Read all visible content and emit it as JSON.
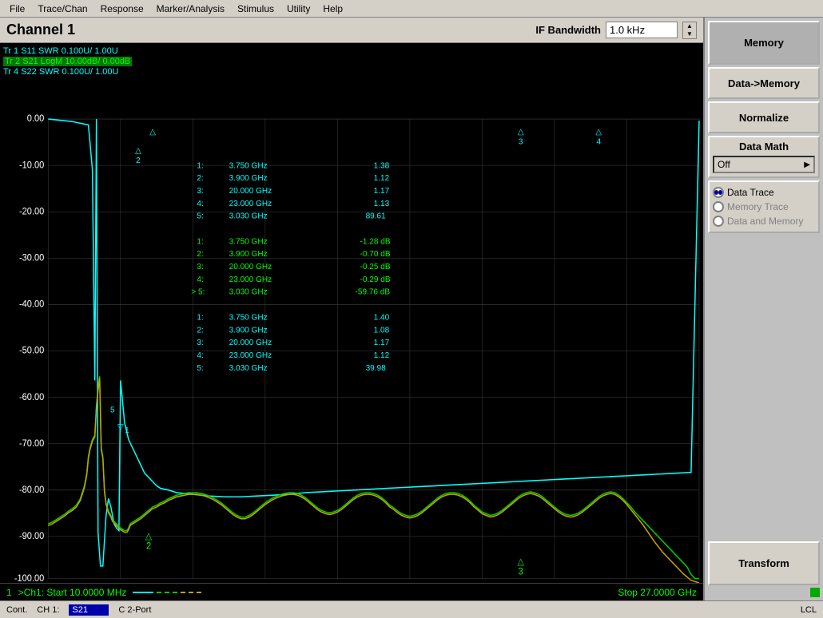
{
  "menubar": {
    "items": [
      "File",
      "Trace/Chan",
      "Response",
      "Marker/Analysis",
      "Stimulus",
      "Utility",
      "Help"
    ]
  },
  "header": {
    "channel_label": "Channel 1",
    "if_bandwidth_label": "IF Bandwidth",
    "if_bandwidth_value": "1.0 kHz"
  },
  "traces": {
    "tr1": "Tr 1  S11 SWR 0.100U/  1.00U",
    "tr2": "Tr 2  S21 LogM 10.00dB/  0.00dB",
    "tr4": "Tr 4  S22 SWR 0.100U/  1.00U"
  },
  "markers": {
    "set1": [
      {
        "num": "1:",
        "freq": "3.750 GHz",
        "val": "1.38"
      },
      {
        "num": "2:",
        "freq": "3.900 GHz",
        "val": "1.12"
      },
      {
        "num": "3:",
        "freq": "20.000 GHz",
        "val": "1.17"
      },
      {
        "num": "4:",
        "freq": "23.000 GHz",
        "val": "1.13"
      },
      {
        "num": "5:",
        "freq": "3.030 GHz",
        "val": "89.61"
      }
    ],
    "set2": [
      {
        "num": "1:",
        "freq": "3.750 GHz",
        "val": "-1.28 dB"
      },
      {
        "num": "2:",
        "freq": "3.900 GHz",
        "val": "-0.70 dB"
      },
      {
        "num": "3:",
        "freq": "20.000 GHz",
        "val": "-0.25 dB"
      },
      {
        "num": "4:",
        "freq": "23.000 GHz",
        "val": "-0.29 dB"
      },
      {
        "num": "> 5:",
        "freq": "3.030 GHz",
        "val": "-59.76 dB"
      }
    ],
    "set3": [
      {
        "num": "1:",
        "freq": "3.750 GHz",
        "val": "1.40"
      },
      {
        "num": "2:",
        "freq": "3.900 GHz",
        "val": "1.08"
      },
      {
        "num": "3:",
        "freq": "20.000 GHz",
        "val": "1.17"
      },
      {
        "num": "4:",
        "freq": "23.000 GHz",
        "val": "1.12"
      },
      {
        "num": "5:",
        "freq": "3.030 GHz",
        "val": "39.98"
      }
    ]
  },
  "chart_bottom": {
    "trace_num": "1",
    "ch_info": ">Ch1: Start  10.0000 MHz",
    "stop_info": "Stop  27.0000 GHz",
    "legend_items": [
      "—",
      "– –",
      "– –"
    ]
  },
  "statusbar": {
    "mode": "Cont.",
    "ch": "CH 1:",
    "param": "S21",
    "port": "C  2-Port",
    "lcl": "LCL"
  },
  "right_panel": {
    "memory_label": "Memory",
    "data_memory_label": "Data->Memory",
    "normalize_label": "Normalize",
    "data_math_label": "Data Math",
    "data_math_value": "Off",
    "data_trace_label": "Data Trace",
    "memory_trace_label": "Memory Trace",
    "data_and_memory_label": "Data and Memory",
    "transform_label": "Transform",
    "selected_radio": "data_trace"
  },
  "colors": {
    "accent_blue": "#0000aa",
    "cyan": "#00ffff",
    "green": "#00ff00",
    "tan": "#c8a000",
    "bg_dark": "#000000",
    "panel_bg": "#c0c0c0"
  }
}
